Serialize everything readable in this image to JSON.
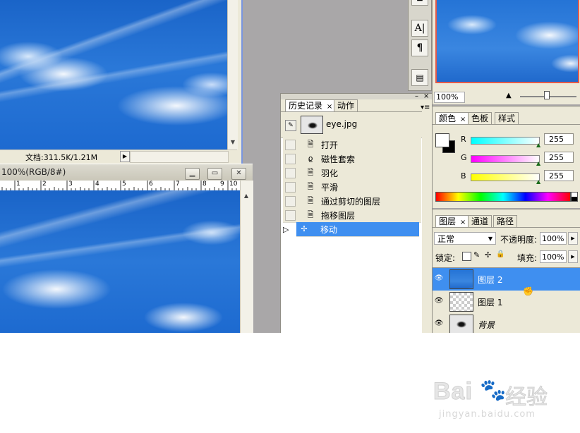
{
  "doc1": {
    "status_text": "文档:311.5K/1.21M"
  },
  "doc2": {
    "title": "100%(RGB/8#)",
    "ruler_ticks": [
      "1",
      "2",
      "3",
      "4",
      "5",
      "6",
      "7",
      "8",
      "9",
      "10"
    ]
  },
  "navigator": {
    "zoom": "100%"
  },
  "history": {
    "tabs": [
      "历史记录",
      "动作"
    ],
    "snapshot_name": "eye.jpg",
    "items": [
      {
        "label": "打开",
        "icon": "document-icon"
      },
      {
        "label": "磁性套索",
        "icon": "magnetic-lasso-icon"
      },
      {
        "label": "羽化",
        "icon": "document-icon"
      },
      {
        "label": "平滑",
        "icon": "document-icon"
      },
      {
        "label": "通过剪切的图层",
        "icon": "document-icon"
      },
      {
        "label": "拖移图层",
        "icon": "document-icon"
      },
      {
        "label": "移动",
        "icon": "move-icon"
      }
    ],
    "selected_index": 6
  },
  "color_panel": {
    "tabs": [
      "颜色",
      "色板",
      "样式"
    ],
    "channels": [
      {
        "name": "R",
        "value": "255",
        "gradient": [
          "#00ffff",
          "#ffffff"
        ]
      },
      {
        "name": "G",
        "value": "255",
        "gradient": [
          "#ff00ff",
          "#ffffff"
        ]
      },
      {
        "name": "B",
        "value": "255",
        "gradient": [
          "#ffff00",
          "#ffffff"
        ]
      }
    ]
  },
  "layers_panel": {
    "tabs": [
      "图层",
      "通道",
      "路径"
    ],
    "blend_mode": "正常",
    "opacity_label": "不透明度:",
    "opacity_value": "100%",
    "lock_label": "锁定:",
    "fill_label": "填充:",
    "fill_value": "100%",
    "layers": [
      {
        "name": "图层 2"
      },
      {
        "name": "图层 1"
      },
      {
        "name": "背景"
      }
    ],
    "selected_index": 0
  },
  "watermark": {
    "brand": "Bai",
    "brand2": "经验",
    "url": "jingyan.baidu.com"
  },
  "colors": {
    "selection_blue": "#3f8ff0",
    "panel_bg": "#ece9d8",
    "workspace": "#a9a7a8"
  }
}
